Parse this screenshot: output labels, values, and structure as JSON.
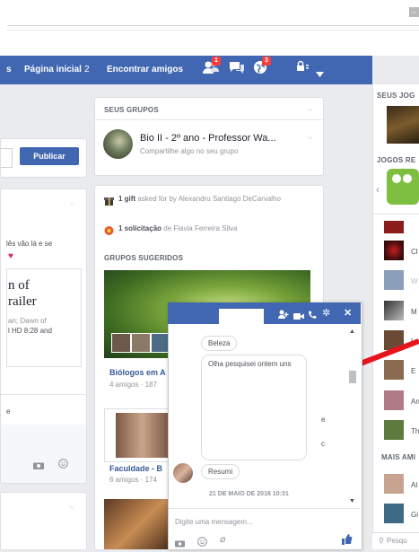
{
  "browser": {
    "window_button": "–"
  },
  "navbar": {
    "home_label": "Página inicial",
    "home_count": "2",
    "find_friends_label": "Encontrar amigos",
    "friend_requests_badge": "1",
    "notifications_badge": "3",
    "left_cut_text": "s"
  },
  "left_column": {
    "publish_button": "Publicar",
    "post_line": "lês vão lá e se",
    "movie_title_1": "n of",
    "movie_title_2": "railer",
    "movie_desc_1": "an; Dawn of",
    "movie_desc_2": "l HD 8:28 and",
    "bottom_letter": "e"
  },
  "groups_card": {
    "heading": "SEUS GRUPOS",
    "group_name": "Bio II - 2º ano - Professor Wa...",
    "group_sub": "Compartilhe algo no seu grupo"
  },
  "notifications_card": {
    "gift_bold": "1 gift",
    "gift_text": " asked for by Alexandru Santiago DeCarvalho",
    "request_bold": "1 solicitação",
    "request_text": " de Flavia Ferreira Silva",
    "suggested_heading": "GRUPOS SUGERIDOS",
    "group1_name": "Biólogos em A",
    "group1_meta": "4 amigos · 187",
    "group2_name": "Faculdade - B",
    "group2_meta": "6 amigos · 174"
  },
  "right_sidebar": {
    "games_heading": "SEUS JOG",
    "games_recent_heading": "JOGOS RE",
    "more_friends_heading": "MAIS AMI",
    "contacts": [
      "Cl",
      "W",
      "M",
      "Lu",
      "E",
      "An",
      "Th"
    ],
    "more_contacts": [
      "Al",
      "Gi"
    ],
    "search_placeholder": "Pesqu"
  },
  "chat": {
    "title": "",
    "time_text": "",
    "messages": [
      {
        "text": "Beleza"
      },
      {
        "text": "Olha pesquisei ontem uns"
      },
      {
        "text": "e"
      },
      {
        "text": "c"
      }
    ],
    "reply": "Resumi",
    "date_separator": "21 DE MAIO DE 2016 10:31",
    "input_placeholder": "Digite uma mensagem..."
  },
  "colors": {
    "brand": "#4267b2",
    "background": "#e9ebee",
    "arrow": "#e8141b"
  }
}
